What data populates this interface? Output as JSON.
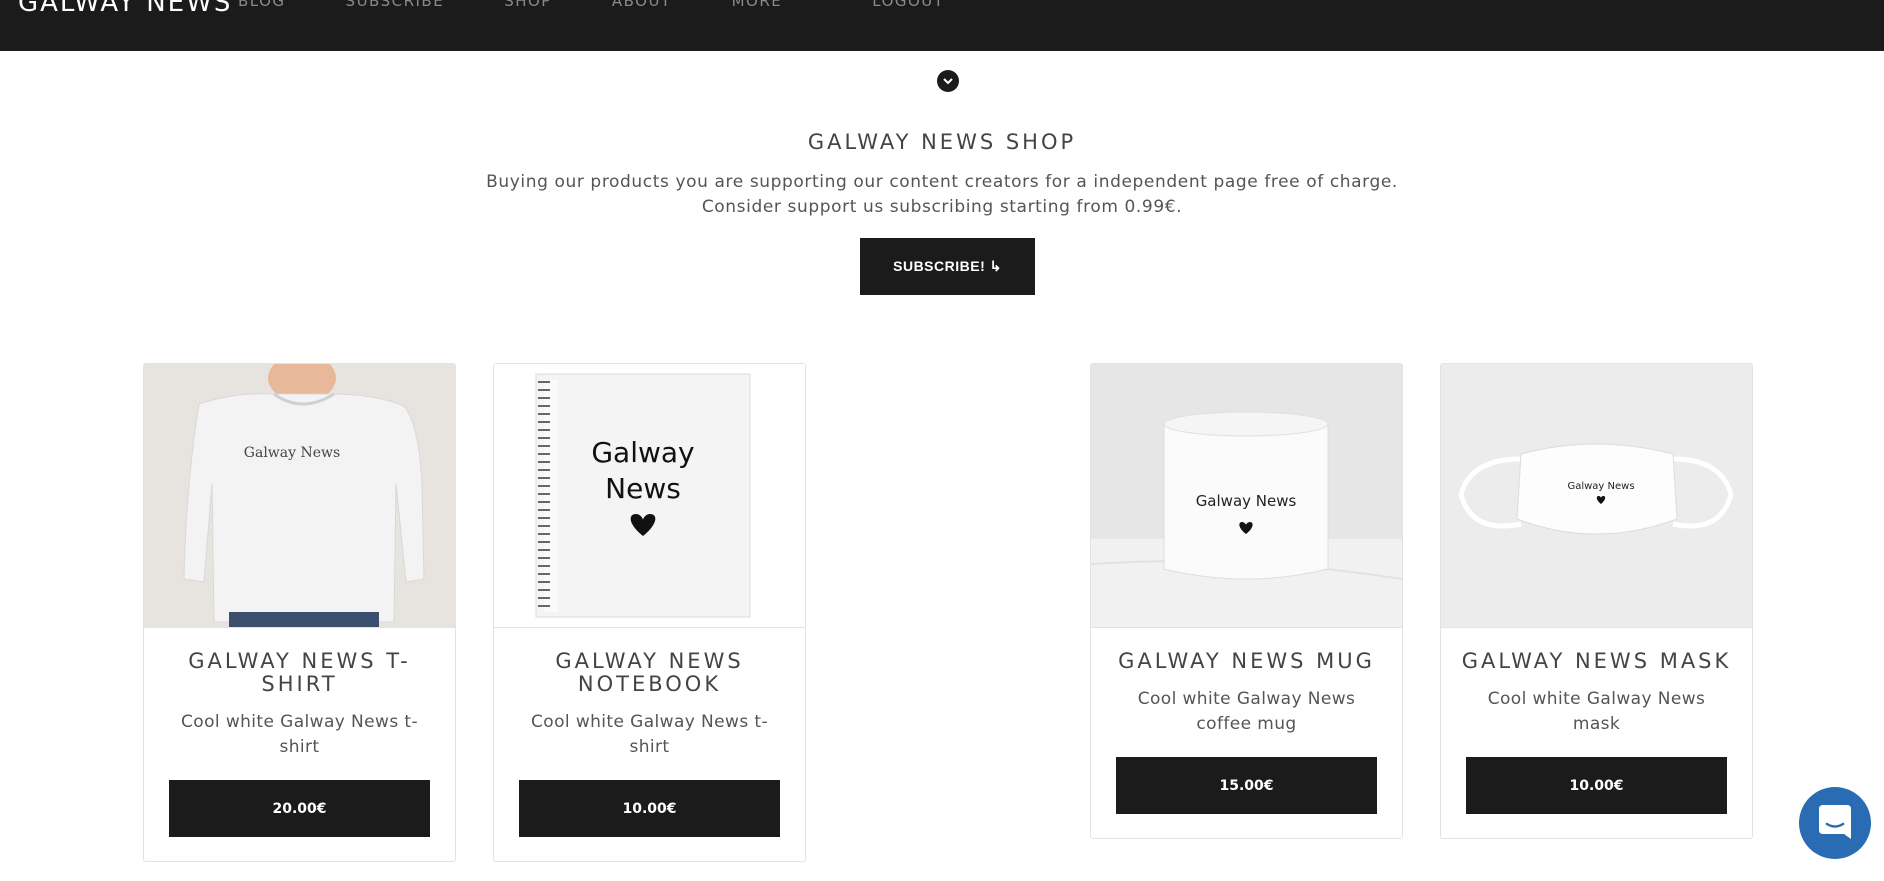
{
  "header": {
    "brand": "GALWAY NEWS",
    "nav": [
      "BLOG",
      "SUBSCRIBE",
      "SHOP",
      "ABOUT",
      "MORE",
      "LOGOUT"
    ]
  },
  "shop": {
    "title": "GALWAY NEWS SHOP",
    "desc_line1": "Buying our products you are supporting our content creators for a independent page free of charge.",
    "desc_line2": "Consider support us subscribing starting from 0.99€.",
    "subscribe_label": "SUBSCRIBE! ↳"
  },
  "products": [
    {
      "name": "GALWAY NEWS T-SHIRT",
      "desc": "Cool white Galway News t-shirt",
      "price": "20.00€",
      "image_text": "Galway News"
    },
    {
      "name": "GALWAY NEWS NOTEBOOK",
      "desc": "Cool white Galway News t-shirt",
      "price": "10.00€",
      "image_text_1": "Galway",
      "image_text_2": "News"
    },
    {
      "name": "GALWAY NEWS MUG",
      "desc": "Cool white Galway News coffee mug",
      "price": "15.00€",
      "image_text": "Galway News"
    },
    {
      "name": "GALWAY NEWS MASK",
      "desc": "Cool white Galway News mask",
      "price": "10.00€",
      "image_text": "Galway News"
    }
  ],
  "icons": {
    "scroll": "chevron-down-icon",
    "chat": "chat-icon"
  },
  "colors": {
    "topbar": "#1b1b1b",
    "button": "#1b1b1b",
    "chat": "#2a6cb3"
  }
}
